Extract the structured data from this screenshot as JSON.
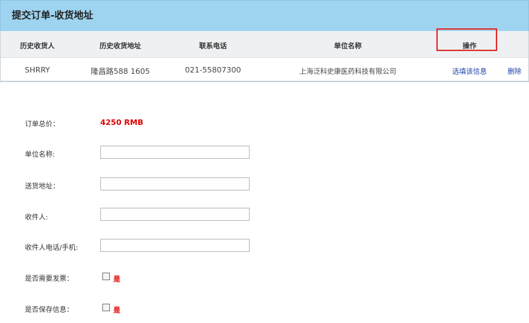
{
  "page": {
    "title": "提交订单-收货地址"
  },
  "history_table": {
    "headers": [
      "历史收货人",
      "历史收货地址",
      "联系电话",
      "单位名称",
      "操作"
    ],
    "rows": [
      {
        "receiver": "SHRRY",
        "address": "隆昌路588 1605",
        "phone": "021-55807300",
        "company": "上海泛科史康医药科技有限公司",
        "select_action": "选填该信息",
        "delete_action": "删除"
      }
    ]
  },
  "form": {
    "total_label": "订单总价：",
    "total_value": "4250 RMB",
    "company_label": "单位名称:",
    "company_value": "",
    "address_label": "送货地址：",
    "address_value": "",
    "receiver_label": "收件人:",
    "receiver_value": "",
    "phone_label": "收件人电话/手机:",
    "phone_value": "",
    "invoice_label": "是否需要发票：",
    "invoice_option": "是",
    "save_label": "是否保存信息：",
    "save_option": "是"
  },
  "colors": {
    "header_bg": "#9fd4f0",
    "price": "#e00000",
    "highlight_border": "#e03030",
    "link": "#1a3fa8"
  }
}
